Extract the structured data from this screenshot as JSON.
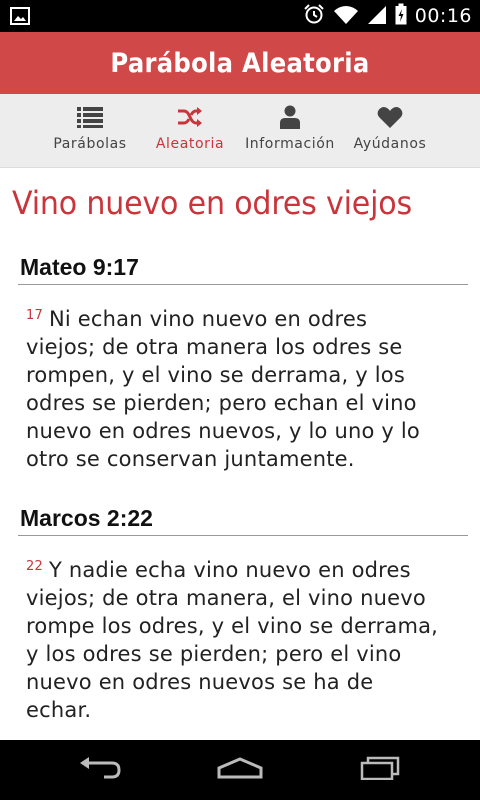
{
  "status_bar": {
    "time": "00:16",
    "icons": [
      "image-notification-icon",
      "alarm-icon",
      "wifi-icon",
      "signal-icon",
      "battery-icon"
    ]
  },
  "app": {
    "title": "Parábola Aleatoria",
    "accent_color": "#d04848",
    "active_color": "#c9353a"
  },
  "tabs": [
    {
      "label": "Parábolas",
      "icon": "list-icon",
      "active": false
    },
    {
      "label": "Aleatoria",
      "icon": "shuffle-icon",
      "active": true
    },
    {
      "label": "Información",
      "icon": "person-icon",
      "active": false
    },
    {
      "label": "Ayúdanos",
      "icon": "heart-icon",
      "active": false
    }
  ],
  "parable": {
    "title": "Vino nuevo en odres viejos",
    "passages": [
      {
        "reference": "Mateo 9:17",
        "verse_number": "17",
        "lines": [
          "Ni echan vino nuevo en odres",
          "viejos; de otra manera los odres se",
          "rompen, y el vino se derrama, y los",
          "odres se pierden; pero echan el vino",
          "nuevo en odres nuevos, y lo uno y lo",
          "otro se conservan juntamente."
        ]
      },
      {
        "reference": "Marcos 2:22",
        "verse_number": "22",
        "lines": [
          "Y nadie echa vino nuevo en odres",
          "viejos; de otra manera, el vino nuevo",
          "rompe los odres, y el vino se derrama,",
          "y los odres se pierden; pero el vino",
          "nuevo en odres nuevos se ha de",
          "echar."
        ]
      }
    ]
  },
  "nav_bar": {
    "buttons": [
      "back-icon",
      "home-icon",
      "recent-apps-icon"
    ]
  }
}
